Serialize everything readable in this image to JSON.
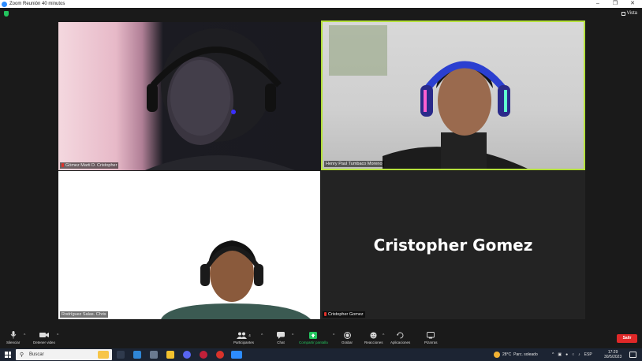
{
  "window": {
    "title": "Zoom Reunión 40 minutos"
  },
  "meeting": {
    "view_label": "Vista",
    "participants": [
      {
        "name": "Gómez Marti D. Cristopher"
      },
      {
        "name": "Henry Paul Tumbaco Moreno"
      },
      {
        "name": "Rodríguez Salas. Chris"
      },
      {
        "name": "Cristopher Gomez",
        "display_name": "Cristopher Gomez"
      }
    ]
  },
  "toolbar": {
    "mute_label": "Silenciar",
    "video_label": "Detener video",
    "participants_label": "Participantes",
    "participants_count": "4",
    "chat_label": "Chat",
    "share_label": "Compartir pantalla",
    "record_label": "Grabar",
    "reactions_label": "Reacciones",
    "apps_label": "Aplicaciones",
    "whiteboard_label": "Pizarras",
    "leave_label": "Salir"
  },
  "taskbar": {
    "search_placeholder": "Buscar",
    "weather_temp": "28°C",
    "weather_text": "Parc. soleado",
    "language": "ESP",
    "time": "17:29",
    "date": "30/5/2023"
  },
  "colors": {
    "active_speaker_border": "#b4e03c",
    "share_green": "#23c45e",
    "leave_red": "#e02828",
    "muted_mic_red": "#e0302a"
  }
}
